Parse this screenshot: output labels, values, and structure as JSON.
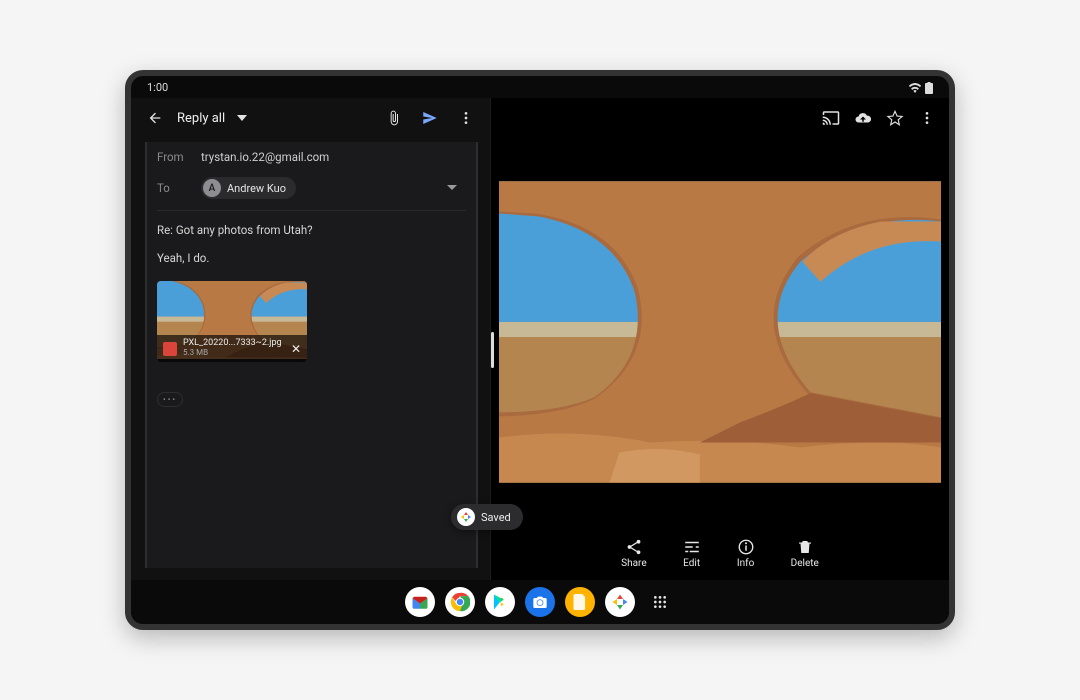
{
  "status": {
    "time": "1:00"
  },
  "gmail": {
    "toolbar": {
      "title": "Reply all"
    },
    "from_label": "From",
    "from": "trystan.io.22@gmail.com",
    "to_label": "To",
    "recipient": {
      "initial": "A",
      "name": "Andrew Kuo"
    },
    "subject": "Re: Got any photos from Utah?",
    "body": "Yeah, I do.",
    "attachment": {
      "name": "PXL_20220...7333~2.jpg",
      "size": "5.3 MB"
    },
    "quoted_toggle": "•••"
  },
  "photos": {
    "saved_label": "Saved",
    "actions": {
      "share": "Share",
      "edit": "Edit",
      "info": "Info",
      "delete": "Delete"
    }
  },
  "taskbar": {
    "apps": [
      "gmail",
      "chrome",
      "play",
      "camera",
      "files",
      "photos",
      "apps"
    ]
  }
}
